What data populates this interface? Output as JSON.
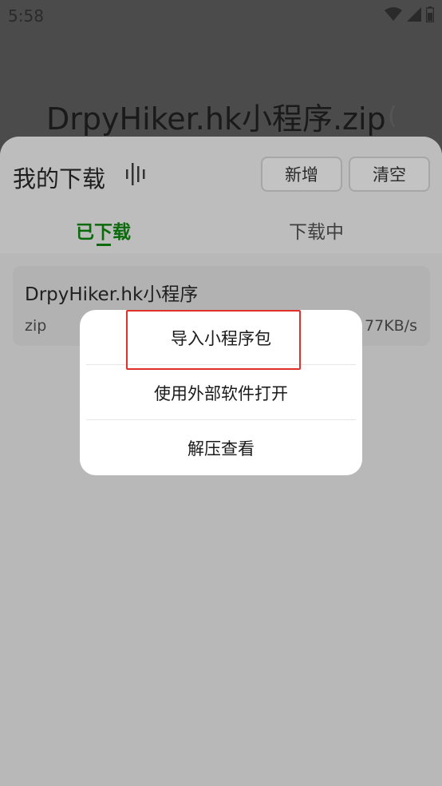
{
  "status_bar": {
    "time": "5:58"
  },
  "background": {
    "title": "DrpyHiker.hk小程序.zip",
    "paren": "("
  },
  "sheet": {
    "title": "我的下载",
    "add_label": "新增",
    "clear_label": "清空",
    "tabs": [
      "已下载",
      "下载中"
    ],
    "item": {
      "name": "DrpyHiker.hk小程序",
      "type": "zip",
      "speed": "77KB/s"
    }
  },
  "dialog": {
    "options": [
      "导入小程序包",
      "使用外部软件打开",
      "解压查看"
    ]
  },
  "colors": {
    "accent_green": "#0b6a0b",
    "highlight_red": "#e0302a"
  }
}
